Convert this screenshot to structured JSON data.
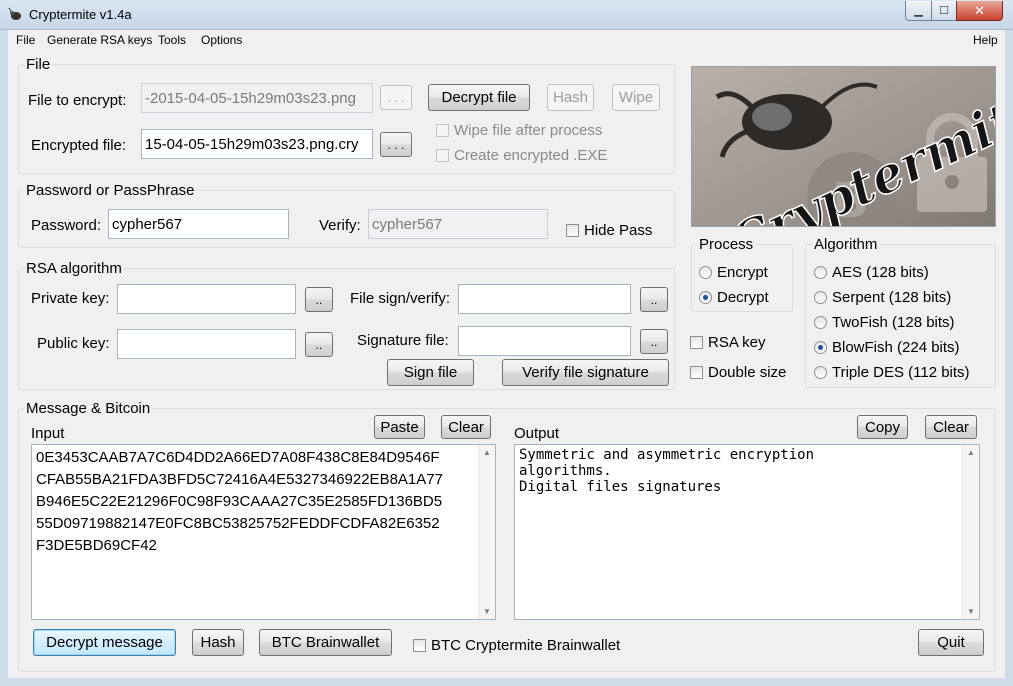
{
  "window": {
    "title": "Cryptermite v1.4a"
  },
  "menu": {
    "file": "File",
    "rsa": "Generate RSA keys",
    "tools": "Tools",
    "options": "Options",
    "help": "Help"
  },
  "file_group": {
    "title": "File",
    "file_to_encrypt_label": "File to encrypt:",
    "file_to_encrypt_value": "-2015-04-05-15h29m03s23.png",
    "encrypted_file_label": "Encrypted file:",
    "encrypted_file_value": "15-04-05-15h29m03s23.png.cry",
    "browse1": ". . .",
    "browse2": ". . .",
    "decrypt_file": "Decrypt file",
    "hash": "Hash",
    "wipe": "Wipe",
    "wipe_after": "Wipe file after process",
    "create_exe": "Create encrypted .EXE"
  },
  "password_group": {
    "title": "Password or PassPhrase",
    "password_label": "Password:",
    "password_value": "cypher567",
    "verify_label": "Verify:",
    "verify_value": "cypher567",
    "hide_pass": "Hide Pass"
  },
  "rsa_group": {
    "title": "RSA algorithm",
    "private_key_label": "Private key:",
    "public_key_label": "Public key:",
    "file_sign_label": "File sign/verify:",
    "signature_file_label": "Signature file:",
    "dots": "..",
    "sign_file": "Sign file",
    "verify_signature": "Verify file signature"
  },
  "logo": {
    "text": "Cryptermite"
  },
  "process_group": {
    "title": "Process",
    "encrypt": "Encrypt",
    "decrypt": "Decrypt",
    "selected": "Decrypt"
  },
  "options": {
    "rsa_key": "RSA key",
    "double_size": "Double size"
  },
  "algorithm_group": {
    "title": "Algorithm",
    "items": [
      "AES (128 bits)",
      "Serpent (128 bits)",
      "TwoFish (128 bits)",
      "BlowFish (224 bits)",
      "Triple DES (112 bits)"
    ],
    "selected": "BlowFish (224 bits)"
  },
  "message_group": {
    "title": "Message & Bitcoin",
    "input_label": "Input",
    "output_label": "Output",
    "paste": "Paste",
    "clear_in": "Clear",
    "copy": "Copy",
    "clear_out": "Clear",
    "input_lines": [
      "0E3453CAAB7A7C6D4DD2A66ED7A08F438C8E84D9546F",
      "CFAB55BA21FDA3BFD5C72416A4E5327346922EB8A1A77",
      "B946E5C22E21296F0C98F93CAAA27C35E2585FD136BD5",
      "55D09719882147E0FC8BC53825752FEDDFCDFA82E6352",
      "F3DE5BD69CF42"
    ],
    "output_lines": [
      "Symmetric and asymmetric encryption",
      "algorithms.",
      "Digital files signatures"
    ],
    "decrypt_message": "Decrypt message",
    "hash": "Hash",
    "btc_brainwallet": "BTC Brainwallet",
    "btc_cryptermite_brainwallet": "BTC Cryptermite Brainwallet",
    "quit": "Quit"
  }
}
